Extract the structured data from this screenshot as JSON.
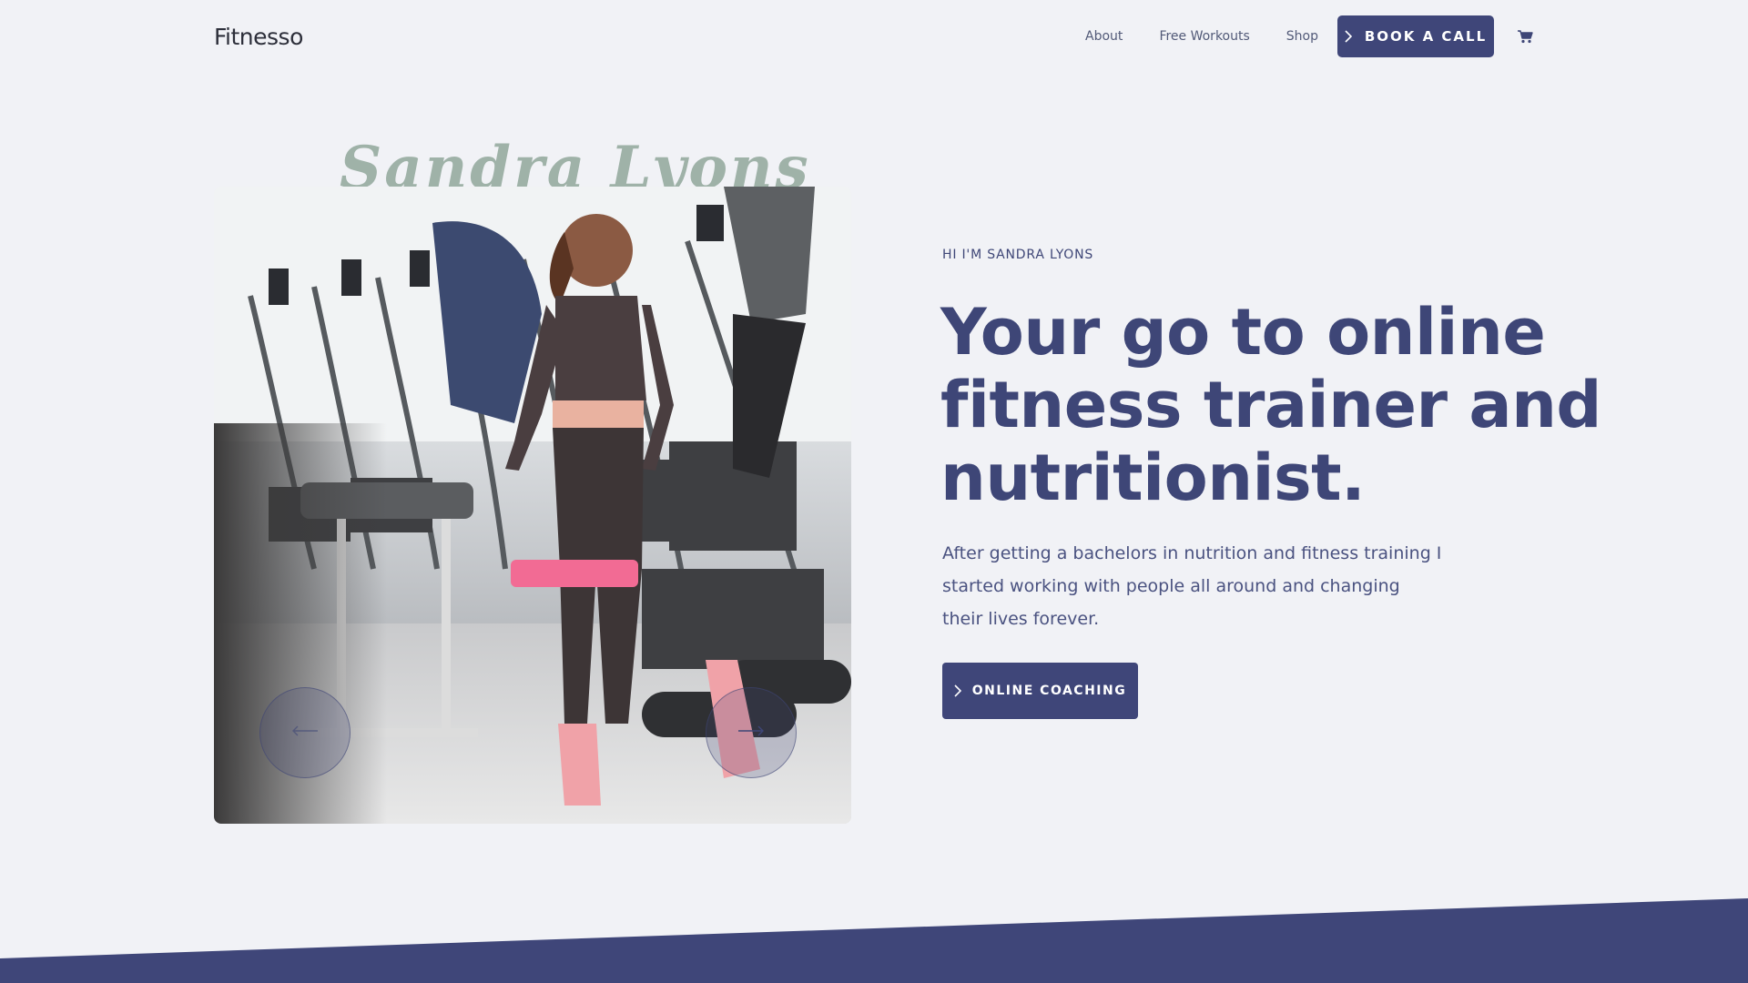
{
  "header": {
    "logo": "Fitnesso",
    "nav": [
      "About",
      "Free Workouts",
      "Shop"
    ],
    "cta_label": "BOOK A CALL",
    "cart_icon": "cart-icon"
  },
  "hero": {
    "script_name": "Sandra Lyons",
    "intro": "HI I'M SANDRA LYONS",
    "headline_lines": [
      "Your go to online",
      "fitness trainer and",
      "nutritionist."
    ],
    "paragraph_lines": [
      "After getting a bachelors in nutrition and fitness training I",
      "started working with people all around and changing",
      "their lives forever."
    ],
    "cta_label": "ONLINE COACHING",
    "carousel": {
      "prev_icon": "arrow-left-icon",
      "next_icon": "arrow-right-icon"
    }
  },
  "colors": {
    "background": "#f1f2f6",
    "primary": "#3f4679",
    "script_name": "#9fb2a8"
  }
}
